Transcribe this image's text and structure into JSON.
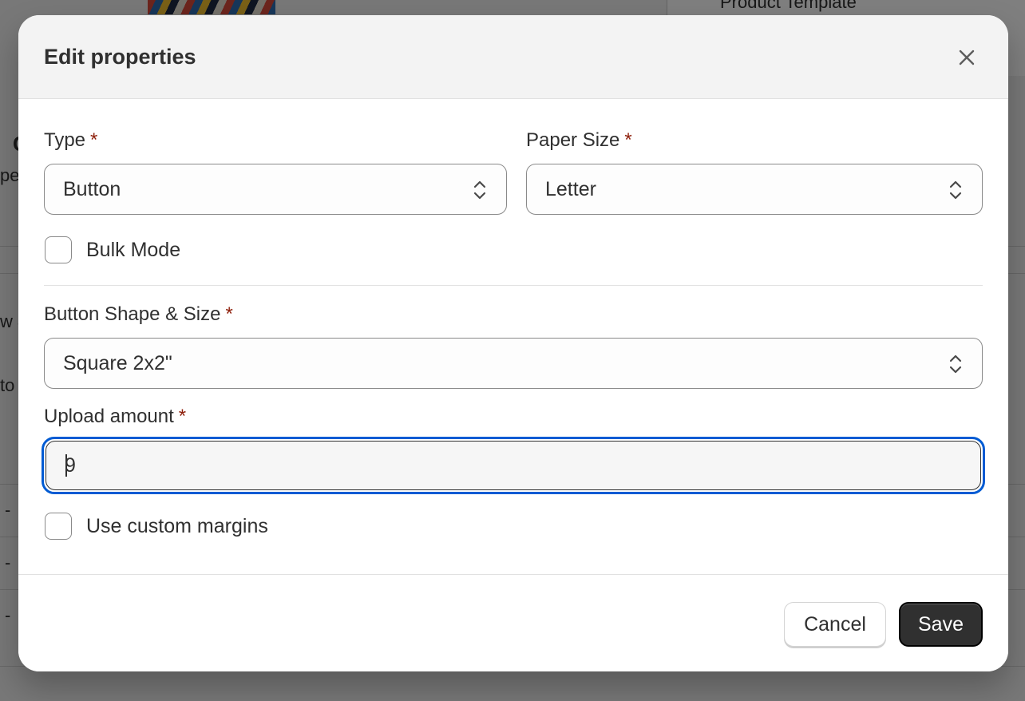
{
  "background": {
    "side_panel_title": "Product Template",
    "fragments": [
      "C",
      "pe",
      "w &",
      "to",
      "-",
      "-",
      "-"
    ]
  },
  "modal": {
    "title": "Edit properties",
    "close_icon": "close-icon",
    "type": {
      "label": "Type",
      "required_mark": "*",
      "value": "Button"
    },
    "paper_size": {
      "label": "Paper Size",
      "required_mark": "*",
      "value": "Letter"
    },
    "bulk_mode": {
      "label": "Bulk Mode",
      "checked": false
    },
    "button_shape_size": {
      "label": "Button Shape & Size",
      "required_mark": "*",
      "value": "Square 2x2\""
    },
    "upload_amount": {
      "label": "Upload amount",
      "required_mark": "*",
      "value": "9"
    },
    "custom_margins": {
      "label": "Use custom margins",
      "checked": false
    },
    "footer": {
      "cancel_label": "Cancel",
      "save_label": "Save"
    }
  },
  "colors": {
    "focus_ring": "#005bd3",
    "required": "#8e1f0b",
    "primary_button": "#303030",
    "overlay": "rgba(0,0,0,0.5)"
  }
}
